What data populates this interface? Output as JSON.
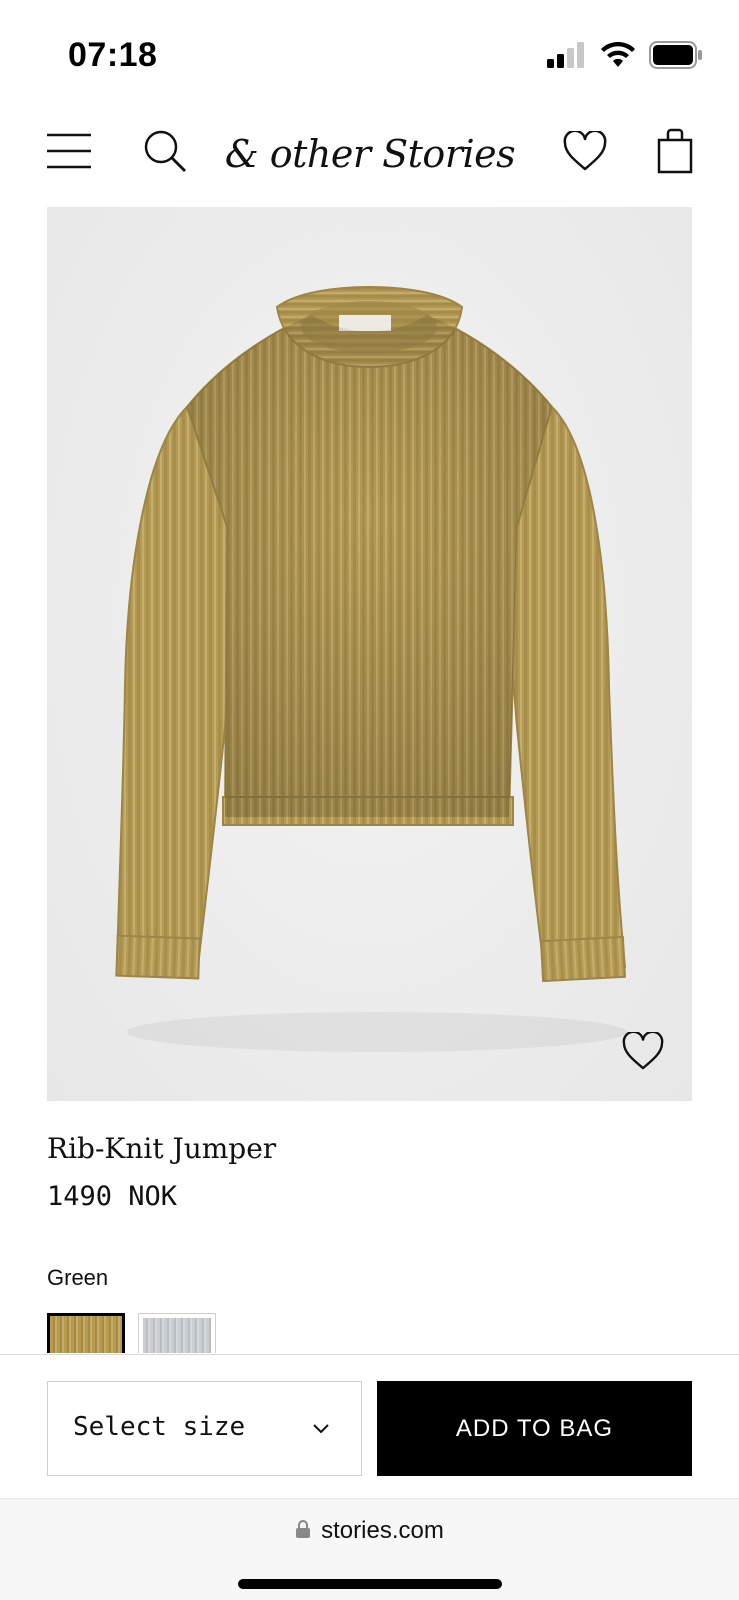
{
  "status_bar": {
    "time": "07:18",
    "icons": [
      "cellular-signal-icon",
      "wifi-icon",
      "battery-icon"
    ]
  },
  "header": {
    "logo_text": "& other Stories",
    "icons": [
      "menu-icon",
      "search-icon",
      "heart-icon",
      "shopping-bag-icon"
    ]
  },
  "product": {
    "title": "Rib-Knit Jumper",
    "price": "1490 NOK",
    "color_label": "Green",
    "swatches": [
      {
        "color": "#b79a4a",
        "selected": true
      },
      {
        "color": "#c9cdd0",
        "selected": false
      }
    ]
  },
  "actions": {
    "size_select_label": "Select size",
    "add_to_bag_label": "ADD TO BAG"
  },
  "browser": {
    "url": "stories.com"
  },
  "colors": {
    "primary_button": "#000000",
    "sweater": "#b79a4a"
  }
}
